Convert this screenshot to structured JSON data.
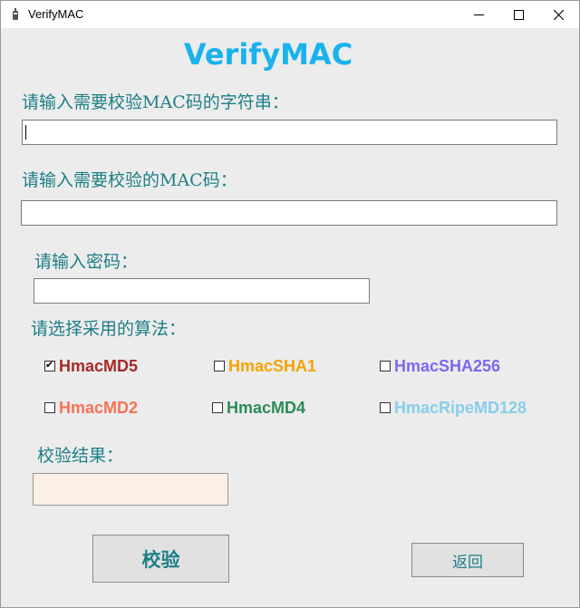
{
  "window": {
    "title": "VerifyMAC"
  },
  "app_title": "VerifyMAC",
  "fields": {
    "string_label": "请输入需要校验MAC码的字符串：",
    "string_value": "",
    "mac_label": "请输入需要校验的MAC码：",
    "mac_value": "",
    "password_label": "请输入密码：",
    "password_value": ""
  },
  "algorithm": {
    "label": "请选择采用的算法：",
    "options": [
      {
        "label": "HmacMD5",
        "checked": true,
        "color": "#a52a2a"
      },
      {
        "label": "HmacSHA1",
        "checked": false,
        "color": "#f5a300"
      },
      {
        "label": "HmacSHA256",
        "checked": false,
        "color": "#7b68ee"
      },
      {
        "label": "HmacMD2",
        "checked": false,
        "color": "#f47257"
      },
      {
        "label": "HmacMD4",
        "checked": false,
        "color": "#2e8b57"
      },
      {
        "label": "HmacRipeMD128",
        "checked": false,
        "color": "#87ceeb"
      }
    ]
  },
  "result": {
    "label": "校验结果：",
    "value": ""
  },
  "buttons": {
    "verify": "校验",
    "back": "返回"
  },
  "icons": {
    "app": "app-icon",
    "minimize": "minimize-icon",
    "maximize": "maximize-icon",
    "close": "close-icon",
    "checkmark": "✔"
  },
  "colors": {
    "title": "#1ab2ec",
    "label": "#1e7f86",
    "result_bg": "#fbf0e6",
    "window_bg": "#ececec"
  }
}
